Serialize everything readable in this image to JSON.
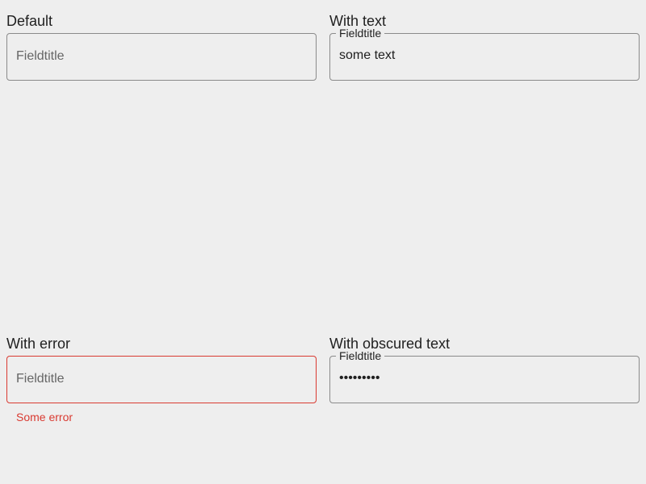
{
  "sections": {
    "default": {
      "title": "Default",
      "placeholder": "Fieldtitle"
    },
    "with_text": {
      "title": "With text",
      "label": "Fieldtitle",
      "value": "some text"
    },
    "with_error": {
      "title": "With error",
      "placeholder": "Fieldtitle",
      "error": "Some error"
    },
    "with_obscured_text": {
      "title": "With obscured text",
      "label": "Fieldtitle",
      "value": "•••••••••"
    }
  },
  "colors": {
    "background": "#eeeeee",
    "border": "#8a8a8a",
    "error": "#d93a31"
  }
}
